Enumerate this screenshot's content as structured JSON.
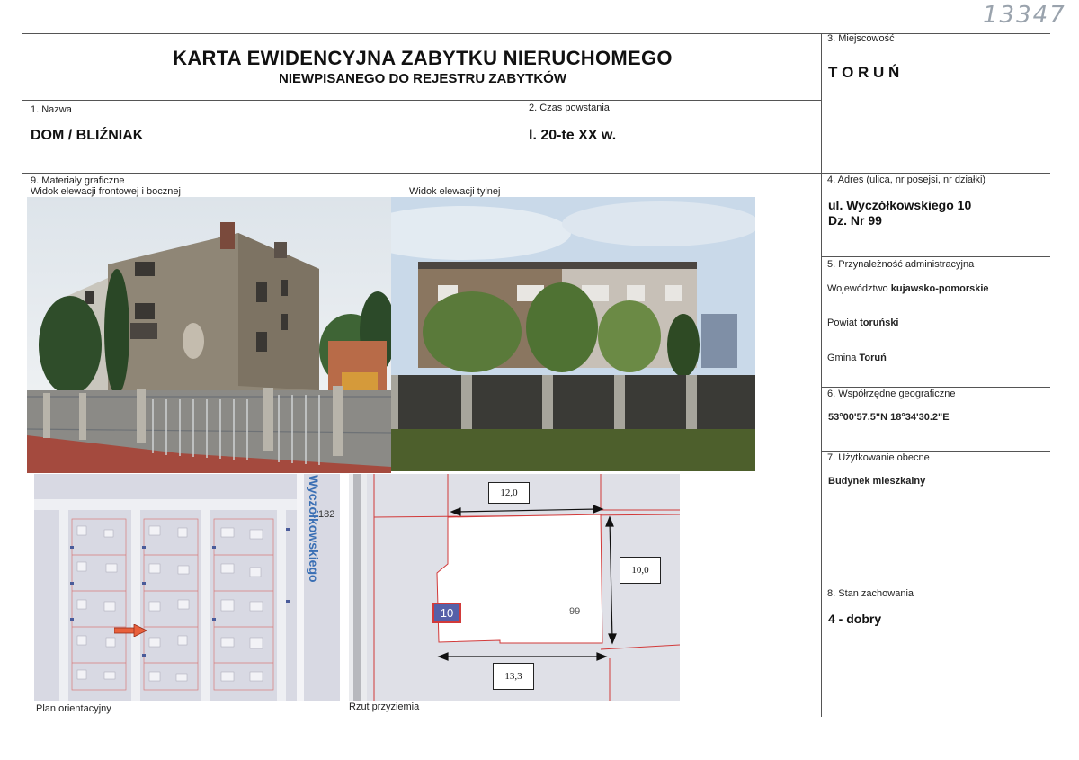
{
  "handwritten_number": "13347",
  "header": {
    "title": "KARTA EWIDENCYJNA ZABYTKU NIERUCHOMEGO",
    "subtitle": "NIEWPISANEGO DO REJESTRU ZABYTKÓW"
  },
  "fields": {
    "nazwa_label": "1. Nazwa",
    "nazwa_value": "DOM / BLIŹNIAK",
    "czas_label": "2. Czas powstania",
    "czas_value": "l. 20-te XX w.",
    "miejscowosc_label": "3. Miejscowość",
    "miejscowosc_value": "T O R U Ń",
    "adres_label": "4. Adres (ulica, nr posejsi, nr działki)",
    "adres_line1": "ul. Wyczółkowskiego 10",
    "adres_line2": "Dz. Nr 99",
    "przynaleznosc_label": "5. Przynależność administracyjna",
    "wojewodztwo_prefix": "Województwo",
    "wojewodztwo_value": "kujawsko-pomorskie",
    "powiat_prefix": "Powiat",
    "powiat_value": "toruński",
    "gmina_prefix": "Gmina",
    "gmina_value": "Toruń",
    "wspolrzedne_label": "6. Współrzędne geograficzne",
    "wspolrzedne_value": "53°00'57.5\"N 18°34'30.2\"E",
    "uzytkowanie_label": "7. Użytkowanie obecne",
    "uzytkowanie_value": "Budynek mieszkalny",
    "stan_label": "8. Stan zachowania",
    "stan_value": "4 - dobry",
    "materialy_label": "9. Materiały graficzne"
  },
  "graphics": {
    "front_caption": "Widok elewacji frontowej i bocznej",
    "rear_caption": "Widok elewacji tylnej",
    "plan_caption": "Plan orientacyjny",
    "rzut_caption": "Rzut przyziemia",
    "street_name": "Wyczółkowskiego",
    "map_number": "182",
    "parcel_label": "10",
    "parcel_number": "99",
    "dim_top": "12,0",
    "dim_right": "10,0",
    "dim_bottom": "13,3"
  },
  "colors": {
    "line": "#555555",
    "map_bg": "#dcdde4",
    "parcel_red": "#d23a3a",
    "arrow": "#e8603c"
  }
}
